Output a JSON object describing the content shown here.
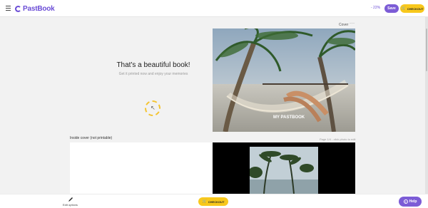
{
  "header": {
    "logo_text": "PastBook",
    "zoom_text": "- 22%",
    "save_label": "Save",
    "checkout_label": "CHECKOUT"
  },
  "cover": {
    "label": "Cover",
    "more_icon": "more-icon",
    "title_on_image": "MY PASTBOOK"
  },
  "promo": {
    "headline": "That's a beautiful book!",
    "subline": "Get it printed now and enjoy your memories"
  },
  "spread": {
    "inside_cover_label": "Inside cover (not printable)",
    "page_info": "Page 1/4 - click photo to edit"
  },
  "footer": {
    "edit_label": "Edit options",
    "checkout_label": "CHECKOUT",
    "help_label": "Help"
  },
  "colors": {
    "brand_purple": "#7c5cd6",
    "checkout_yellow": "#f8c81c"
  }
}
